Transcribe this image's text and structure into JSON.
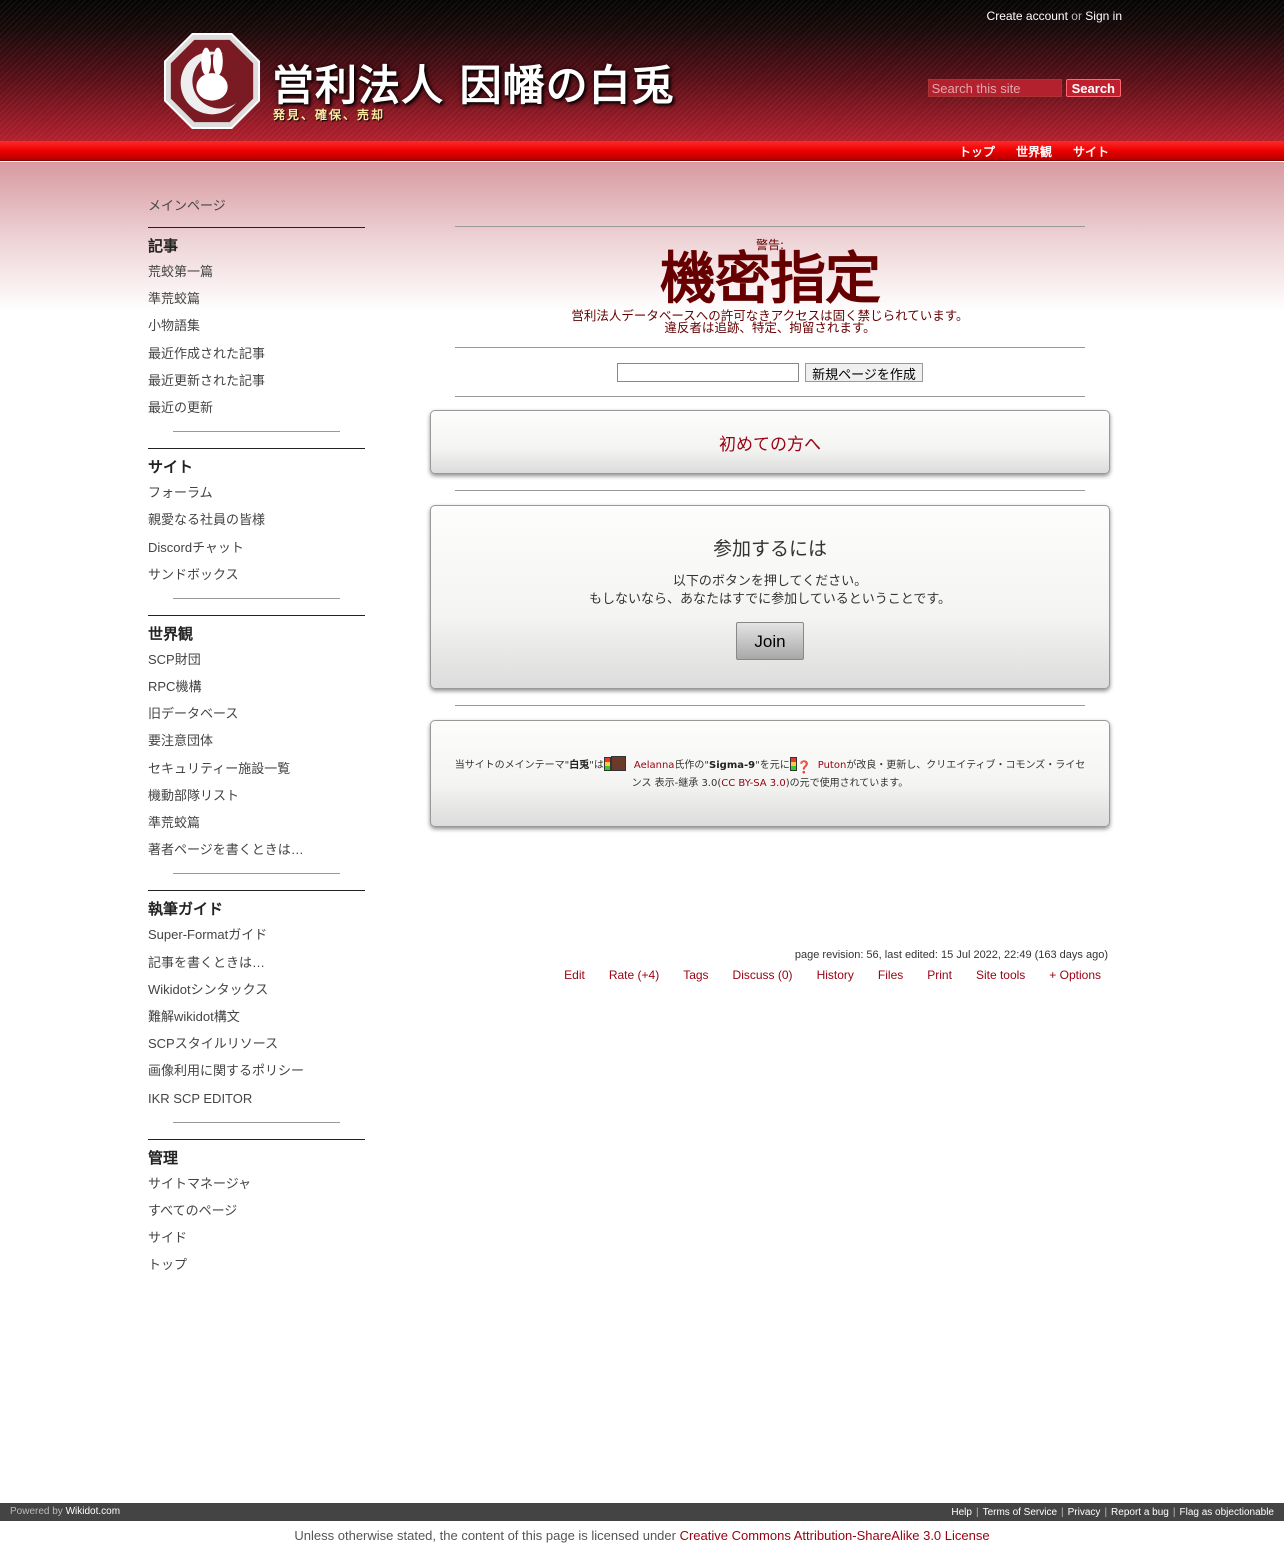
{
  "account": {
    "create": "Create account",
    "or": "or",
    "signin": "Sign in"
  },
  "header": {
    "title": "営利法人 因幡の白兎",
    "subtitle": "発見、確保、売却",
    "search_placeholder": "Search this site",
    "search_button": "Search"
  },
  "top_nav": [
    "トップ",
    "世界観",
    "サイト"
  ],
  "sidebar": {
    "top_link": "メインページ",
    "sections": [
      {
        "heading": "記事",
        "items": [
          "荒蛟第一篇",
          "準荒蛟篇",
          "小物語集",
          "最近作成された記事",
          "最近更新された記事",
          "最近の更新"
        ]
      },
      {
        "heading": "サイト",
        "items": [
          "フォーラム",
          "親愛なる社員の皆様",
          "Discordチャット",
          "サンドボックス"
        ]
      },
      {
        "heading": "世界観",
        "items": [
          "SCP財団",
          "RPC機構",
          "旧データベース",
          "要注意団体",
          "セキュリティー施設一覧",
          "機動部隊リスト",
          "準荒蛟篇",
          "著者ページを書くときは…"
        ]
      },
      {
        "heading": "執筆ガイド",
        "items": [
          "Super-Formatガイド",
          "記事を書くときは…",
          "Wikidotシンタックス",
          "難解wikidot構文",
          "SCPスタイルリソース",
          "画像利用に関するポリシー",
          "IKR SCP EDITOR"
        ]
      },
      {
        "heading": "管理",
        "items": [
          "サイトマネージャ",
          "すべてのページ",
          "サイド",
          "トップ"
        ]
      }
    ]
  },
  "main": {
    "warning_label": "警告:",
    "warning_title": "機密指定",
    "warning_line1": "営利法人データベースへの許可なきアクセスは固く禁じられています。",
    "warning_line2": "違反者は追跡、特定、拘留されます。",
    "new_page_button": "新規ページを作成",
    "intro_link": "初めての方へ",
    "join_title": "参加するには",
    "join_line1": "以下のボタンを押してください。",
    "join_line2": "もしないなら、あなたはすでに参加しているということです。",
    "join_button": "Join",
    "license": {
      "p1": "当サイトのメインテーマ\"",
      "theme": "白兎",
      "p2": "\"は",
      "author1": "Aelanna",
      "p3": "氏作の\"",
      "base": "Sigma-9",
      "p4": "\"を元に",
      "author2": "Puton",
      "p5": "が改良・更新し、クリエイティブ・コモンズ・ライセンス 表示-継承 3.0(",
      "cc": "CC BY-SA 3.0",
      "p6": ")の元で使用されています。"
    }
  },
  "page_info": "page revision: 56, last edited: 15 Jul 2022, 22:49 (163 days ago)",
  "page_options": [
    "Edit",
    "Rate (+4)",
    "Tags",
    "Discuss (0)",
    "History",
    "Files",
    "Print",
    "Site tools",
    "+ Options"
  ],
  "footer": {
    "powered": "Powered by",
    "wikidot": "Wikidot.com",
    "links": [
      "Help",
      "Terms of Service",
      "Privacy",
      "Report a bug",
      "Flag as objectionable"
    ],
    "license_text": "Unless otherwise stated, the content of this page is licensed under",
    "license_link": "Creative Commons Attribution-ShareAlike 3.0 License"
  },
  "colors": {
    "accent": "#990011",
    "header_red": "#b3202e",
    "warning": "#660000"
  }
}
